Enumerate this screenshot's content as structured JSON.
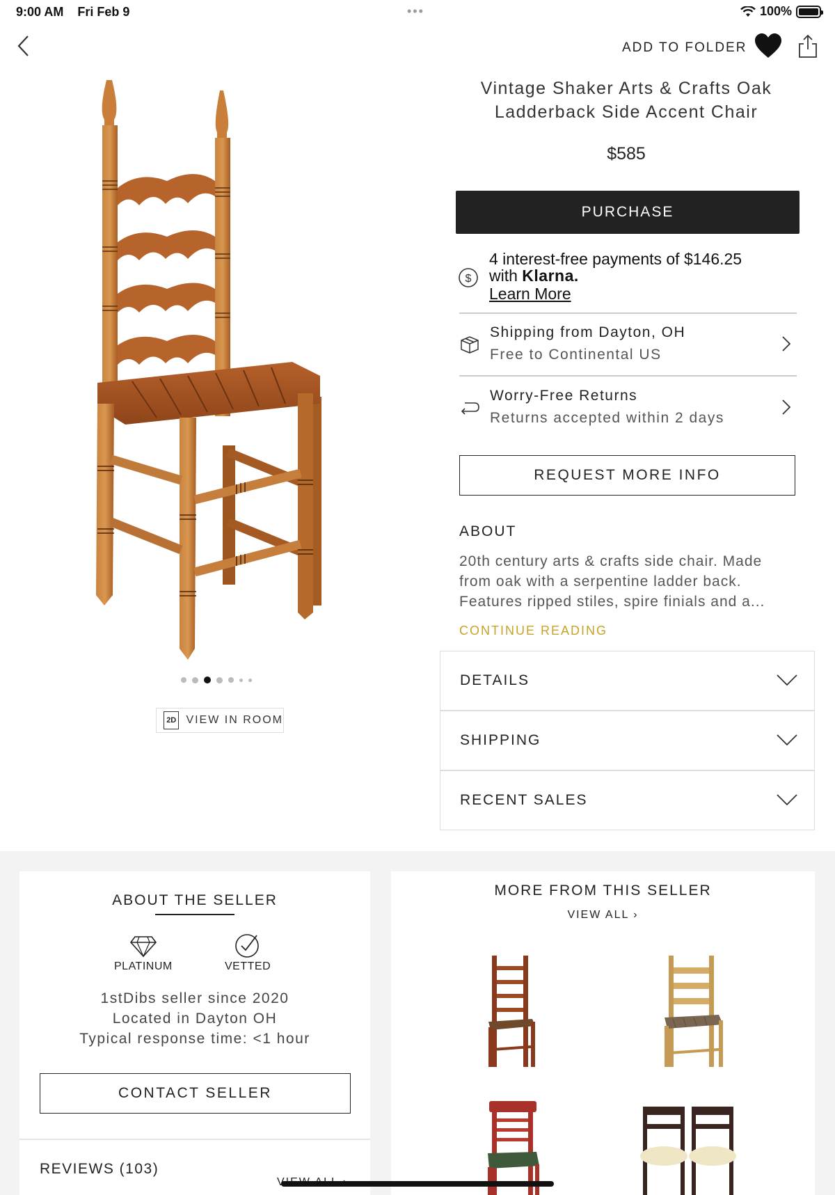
{
  "status_bar": {
    "time": "9:00 AM",
    "date": "Fri Feb 9",
    "dots": "•••",
    "battery_text": "100%",
    "battery_level": 1.0
  },
  "nav": {
    "add_to_folder": "ADD TO FOLDER",
    "icons": [
      "back-chevron-icon",
      "heart-icon",
      "share-icon"
    ]
  },
  "product": {
    "title_line1": "Vintage Shaker Arts & Crafts Oak",
    "title_line2": "Ladderback Side Accent Chair",
    "price": "$585",
    "purchase_label": "PURCHASE",
    "carousel": {
      "count": 7,
      "active_index": 2
    },
    "view_in_room": {
      "badge": "2D",
      "label": "VIEW IN ROOM"
    }
  },
  "klarna": {
    "line1": "4 interest-free payments of $146.25",
    "line2_prefix": "with ",
    "brand": "Klarna.",
    "learn_more": "Learn More"
  },
  "shipping_row": {
    "title": "Shipping from Dayton, OH",
    "subtitle": "Free to Continental US"
  },
  "returns_row": {
    "title": "Worry-Free Returns",
    "subtitle": "Returns accepted within 2 days"
  },
  "request_info_label": "REQUEST MORE INFO",
  "about": {
    "heading": "ABOUT",
    "line1": "20th century arts & crafts side chair. Made",
    "line2": "from oak with a serpentine ladder back.",
    "line3": "Features ripped stiles, spire finials and a...",
    "continue_label": "CONTINUE READING"
  },
  "accordions": {
    "details": "DETAILS",
    "shipping": "SHIPPING",
    "recent_sales": "RECENT SALES"
  },
  "seller": {
    "heading": "ABOUT THE SELLER",
    "badge1": "PLATINUM",
    "badge2": "VETTED",
    "since": "1stDibs seller since 2020",
    "location": "Located in Dayton OH",
    "response": "Typical response time: <1 hour",
    "contact_label": "CONTACT SELLER",
    "reviews": "REVIEWS (103)",
    "reviews_view_all": "VIEW ALL ›"
  },
  "more_from_seller": {
    "heading": "MORE FROM THIS SELLER",
    "view_all": "VIEW ALL ›"
  },
  "colors": {
    "accent_gold": "#c9a227",
    "button_dark": "#222222",
    "wood": "#b8692a"
  }
}
